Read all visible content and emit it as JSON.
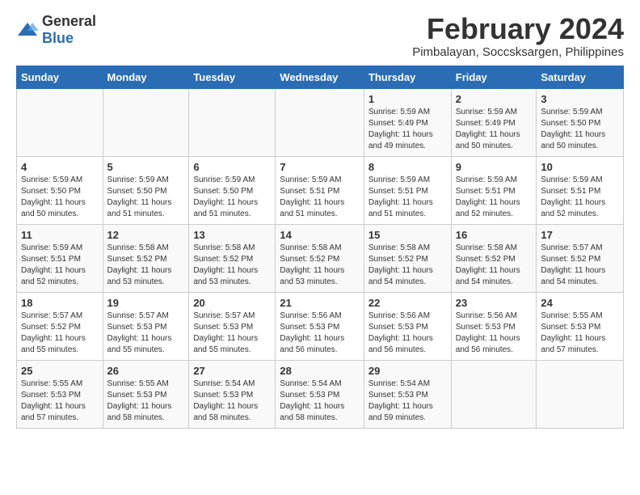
{
  "header": {
    "logo_general": "General",
    "logo_blue": "Blue",
    "title": "February 2024",
    "subtitle": "Pimbalayan, Soccsksargen, Philippines"
  },
  "calendar": {
    "days_of_week": [
      "Sunday",
      "Monday",
      "Tuesday",
      "Wednesday",
      "Thursday",
      "Friday",
      "Saturday"
    ],
    "weeks": [
      [
        {
          "day": "",
          "sunrise": "",
          "sunset": "",
          "daylight": ""
        },
        {
          "day": "",
          "sunrise": "",
          "sunset": "",
          "daylight": ""
        },
        {
          "day": "",
          "sunrise": "",
          "sunset": "",
          "daylight": ""
        },
        {
          "day": "",
          "sunrise": "",
          "sunset": "",
          "daylight": ""
        },
        {
          "day": "1",
          "sunrise": "Sunrise: 5:59 AM",
          "sunset": "Sunset: 5:49 PM",
          "daylight": "Daylight: 11 hours and 49 minutes."
        },
        {
          "day": "2",
          "sunrise": "Sunrise: 5:59 AM",
          "sunset": "Sunset: 5:49 PM",
          "daylight": "Daylight: 11 hours and 50 minutes."
        },
        {
          "day": "3",
          "sunrise": "Sunrise: 5:59 AM",
          "sunset": "Sunset: 5:50 PM",
          "daylight": "Daylight: 11 hours and 50 minutes."
        }
      ],
      [
        {
          "day": "4",
          "sunrise": "Sunrise: 5:59 AM",
          "sunset": "Sunset: 5:50 PM",
          "daylight": "Daylight: 11 hours and 50 minutes."
        },
        {
          "day": "5",
          "sunrise": "Sunrise: 5:59 AM",
          "sunset": "Sunset: 5:50 PM",
          "daylight": "Daylight: 11 hours and 51 minutes."
        },
        {
          "day": "6",
          "sunrise": "Sunrise: 5:59 AM",
          "sunset": "Sunset: 5:50 PM",
          "daylight": "Daylight: 11 hours and 51 minutes."
        },
        {
          "day": "7",
          "sunrise": "Sunrise: 5:59 AM",
          "sunset": "Sunset: 5:51 PM",
          "daylight": "Daylight: 11 hours and 51 minutes."
        },
        {
          "day": "8",
          "sunrise": "Sunrise: 5:59 AM",
          "sunset": "Sunset: 5:51 PM",
          "daylight": "Daylight: 11 hours and 51 minutes."
        },
        {
          "day": "9",
          "sunrise": "Sunrise: 5:59 AM",
          "sunset": "Sunset: 5:51 PM",
          "daylight": "Daylight: 11 hours and 52 minutes."
        },
        {
          "day": "10",
          "sunrise": "Sunrise: 5:59 AM",
          "sunset": "Sunset: 5:51 PM",
          "daylight": "Daylight: 11 hours and 52 minutes."
        }
      ],
      [
        {
          "day": "11",
          "sunrise": "Sunrise: 5:59 AM",
          "sunset": "Sunset: 5:51 PM",
          "daylight": "Daylight: 11 hours and 52 minutes."
        },
        {
          "day": "12",
          "sunrise": "Sunrise: 5:58 AM",
          "sunset": "Sunset: 5:52 PM",
          "daylight": "Daylight: 11 hours and 53 minutes."
        },
        {
          "day": "13",
          "sunrise": "Sunrise: 5:58 AM",
          "sunset": "Sunset: 5:52 PM",
          "daylight": "Daylight: 11 hours and 53 minutes."
        },
        {
          "day": "14",
          "sunrise": "Sunrise: 5:58 AM",
          "sunset": "Sunset: 5:52 PM",
          "daylight": "Daylight: 11 hours and 53 minutes."
        },
        {
          "day": "15",
          "sunrise": "Sunrise: 5:58 AM",
          "sunset": "Sunset: 5:52 PM",
          "daylight": "Daylight: 11 hours and 54 minutes."
        },
        {
          "day": "16",
          "sunrise": "Sunrise: 5:58 AM",
          "sunset": "Sunset: 5:52 PM",
          "daylight": "Daylight: 11 hours and 54 minutes."
        },
        {
          "day": "17",
          "sunrise": "Sunrise: 5:57 AM",
          "sunset": "Sunset: 5:52 PM",
          "daylight": "Daylight: 11 hours and 54 minutes."
        }
      ],
      [
        {
          "day": "18",
          "sunrise": "Sunrise: 5:57 AM",
          "sunset": "Sunset: 5:52 PM",
          "daylight": "Daylight: 11 hours and 55 minutes."
        },
        {
          "day": "19",
          "sunrise": "Sunrise: 5:57 AM",
          "sunset": "Sunset: 5:53 PM",
          "daylight": "Daylight: 11 hours and 55 minutes."
        },
        {
          "day": "20",
          "sunrise": "Sunrise: 5:57 AM",
          "sunset": "Sunset: 5:53 PM",
          "daylight": "Daylight: 11 hours and 55 minutes."
        },
        {
          "day": "21",
          "sunrise": "Sunrise: 5:56 AM",
          "sunset": "Sunset: 5:53 PM",
          "daylight": "Daylight: 11 hours and 56 minutes."
        },
        {
          "day": "22",
          "sunrise": "Sunrise: 5:56 AM",
          "sunset": "Sunset: 5:53 PM",
          "daylight": "Daylight: 11 hours and 56 minutes."
        },
        {
          "day": "23",
          "sunrise": "Sunrise: 5:56 AM",
          "sunset": "Sunset: 5:53 PM",
          "daylight": "Daylight: 11 hours and 56 minutes."
        },
        {
          "day": "24",
          "sunrise": "Sunrise: 5:55 AM",
          "sunset": "Sunset: 5:53 PM",
          "daylight": "Daylight: 11 hours and 57 minutes."
        }
      ],
      [
        {
          "day": "25",
          "sunrise": "Sunrise: 5:55 AM",
          "sunset": "Sunset: 5:53 PM",
          "daylight": "Daylight: 11 hours and 57 minutes."
        },
        {
          "day": "26",
          "sunrise": "Sunrise: 5:55 AM",
          "sunset": "Sunset: 5:53 PM",
          "daylight": "Daylight: 11 hours and 58 minutes."
        },
        {
          "day": "27",
          "sunrise": "Sunrise: 5:54 AM",
          "sunset": "Sunset: 5:53 PM",
          "daylight": "Daylight: 11 hours and 58 minutes."
        },
        {
          "day": "28",
          "sunrise": "Sunrise: 5:54 AM",
          "sunset": "Sunset: 5:53 PM",
          "daylight": "Daylight: 11 hours and 58 minutes."
        },
        {
          "day": "29",
          "sunrise": "Sunrise: 5:54 AM",
          "sunset": "Sunset: 5:53 PM",
          "daylight": "Daylight: 11 hours and 59 minutes."
        },
        {
          "day": "",
          "sunrise": "",
          "sunset": "",
          "daylight": ""
        },
        {
          "day": "",
          "sunrise": "",
          "sunset": "",
          "daylight": ""
        }
      ]
    ]
  }
}
